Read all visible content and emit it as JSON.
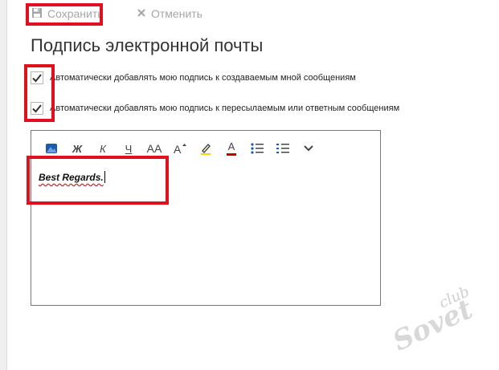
{
  "toolbar": {
    "save_label": "Сохранить",
    "cancel_label": "Отменить"
  },
  "page_title": "Подпись электронной почты",
  "options": {
    "auto_new": {
      "label": "Автоматически добавлять мою подпись к создаваемым мной сообщениям",
      "checked": true
    },
    "auto_reply": {
      "label": "Автоматически добавлять мою подпись к пересылаемым или ответным сообщениям",
      "checked": true
    }
  },
  "format_toolbar": {
    "bold": "Ж",
    "italic": "К",
    "underline": "Ч",
    "font_size": "AA",
    "font_color": "A"
  },
  "editor": {
    "signature_text": "Best Regards."
  },
  "watermark": {
    "text": "club Sovet"
  },
  "colors": {
    "highlight": "#e0101e",
    "accent_blue": "#1e5aa8"
  }
}
